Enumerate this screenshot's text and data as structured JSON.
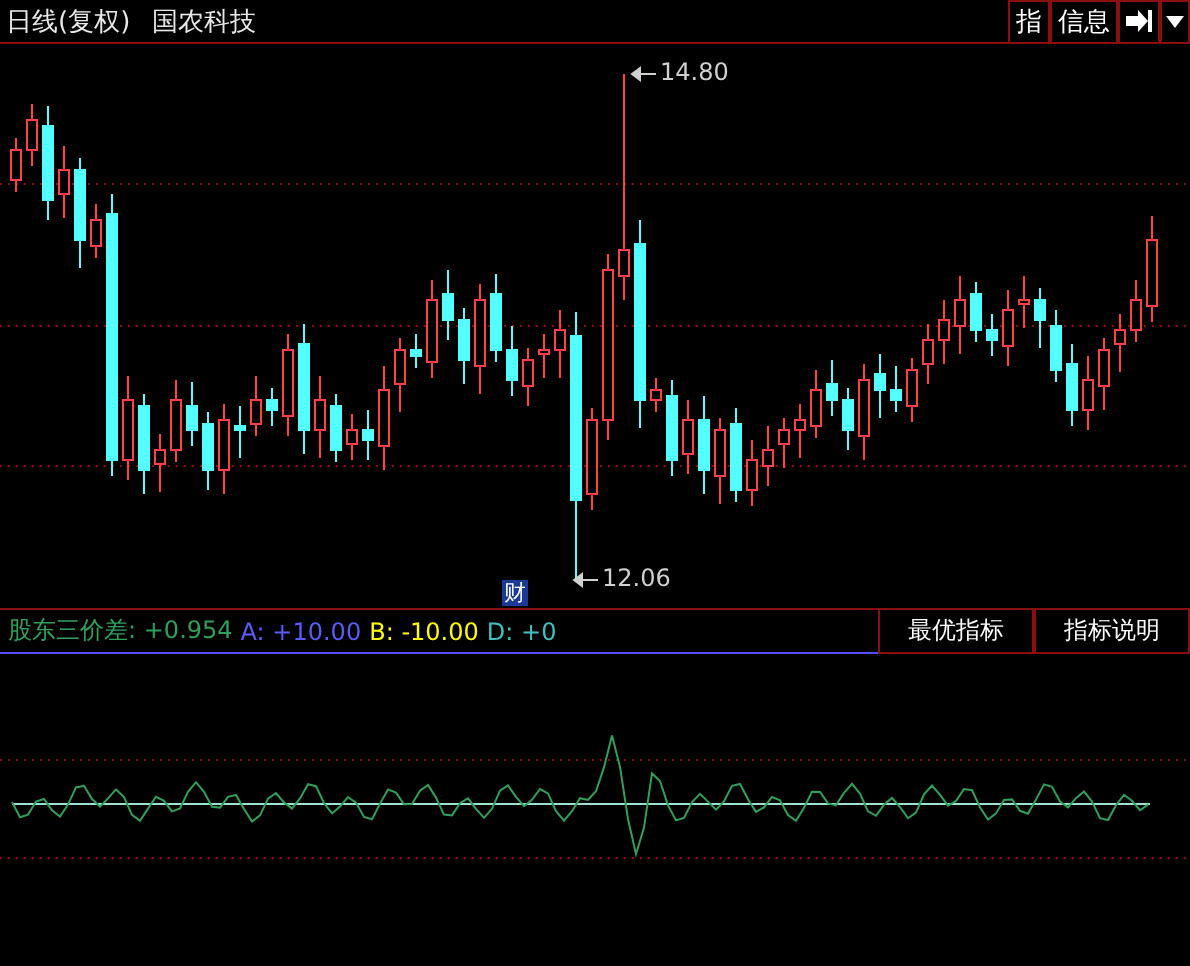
{
  "toolbar": {
    "period": "日线(复权)",
    "stock": "国农科技",
    "buttons": [
      {
        "label": "指"
      },
      {
        "label": "信息"
      }
    ]
  },
  "price_chart": {
    "high_label": "14.80",
    "low_label": "12.06",
    "event_marker": "财"
  },
  "indicator": {
    "values": [
      {
        "label": "股东三价差:",
        "value": "+0.954",
        "color": "#2fa05a"
      },
      {
        "label": "A:",
        "value": "+10.00",
        "color": "#5a5aff"
      },
      {
        "label": "B:",
        "value": "-10.00",
        "color": "#ffff00"
      },
      {
        "label": "D:",
        "value": "+0",
        "color": "#40c0c0"
      }
    ],
    "buttons": [
      {
        "label": "最优指标"
      },
      {
        "label": "指标说明"
      }
    ]
  }
}
